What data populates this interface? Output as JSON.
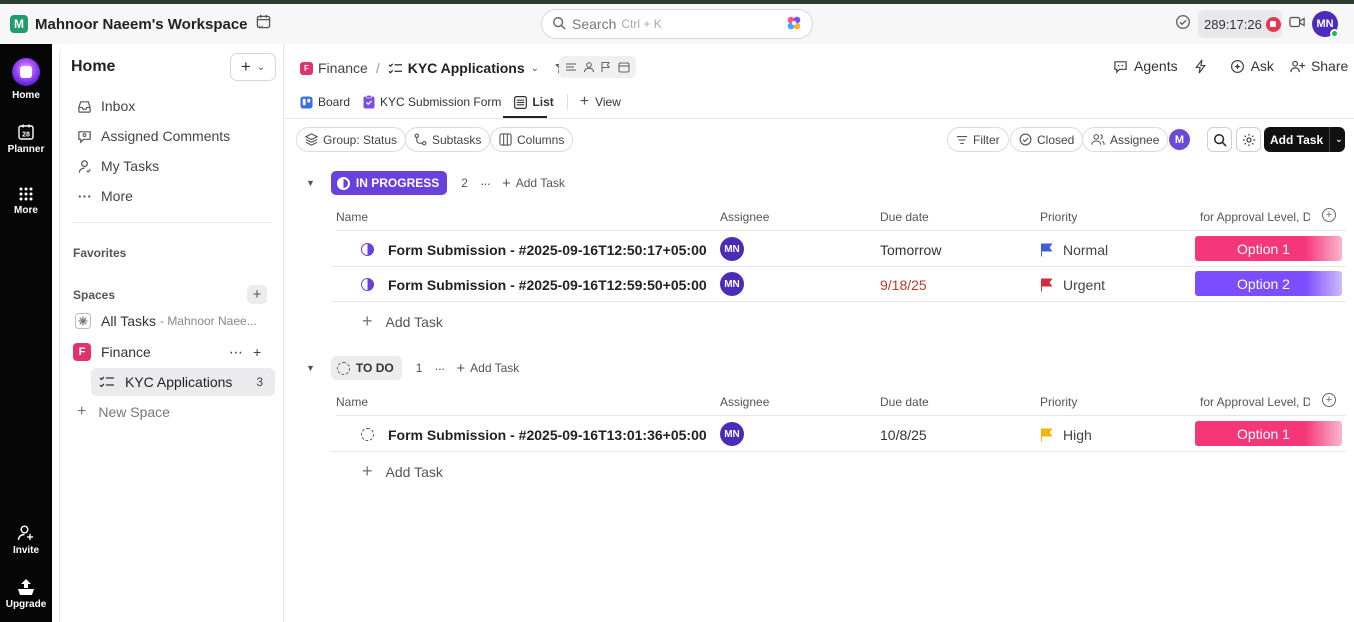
{
  "topbar": {
    "workspace_initial": "M",
    "workspace_name": "Mahnoor Naeem's Workspace",
    "search_placeholder": "Search",
    "search_shortcut": "Ctrl + K",
    "timer": "289:17:26",
    "user_initials": "MN"
  },
  "rail": {
    "items": [
      {
        "label": "Home",
        "icon": "home-icon"
      },
      {
        "label": "Planner",
        "icon": "calendar-icon"
      },
      {
        "label": "More",
        "icon": "grid-icon"
      },
      {
        "label": "Invite",
        "icon": "add-user-icon"
      },
      {
        "label": "Upgrade",
        "icon": "upgrade-icon"
      }
    ],
    "planner_day": "28"
  },
  "sidebar": {
    "title": "Home",
    "add_label": "+",
    "nav": [
      {
        "label": "Inbox",
        "icon": "inbox-icon"
      },
      {
        "label": "Assigned Comments",
        "icon": "comment-icon"
      },
      {
        "label": "My Tasks",
        "icon": "user-icon"
      },
      {
        "label": "More",
        "icon": "ellipsis-icon"
      }
    ],
    "favorites_label": "Favorites",
    "spaces_label": "Spaces",
    "all_tasks_label": "All Tasks",
    "all_tasks_sub": "- Mahnoor Naee...",
    "space_initial": "F",
    "space_name": "Finance",
    "list_name": "KYC Applications",
    "list_count": "3",
    "new_space_label": "New Space"
  },
  "header": {
    "breadcrumb_initial": "F",
    "breadcrumb_space": "Finance",
    "breadcrumb_sep": "/",
    "breadcrumb_list": "KYC Applications",
    "actions": [
      "Agents",
      "Ask",
      "Share"
    ]
  },
  "views": {
    "tabs": [
      {
        "label": "Board",
        "icon": "board-icon"
      },
      {
        "label": "KYC Submission Form",
        "icon": "form-icon"
      },
      {
        "label": "List",
        "icon": "list-icon",
        "active": true
      }
    ],
    "add_view_label": "View"
  },
  "toolbar": {
    "group_label": "Group: Status",
    "subtasks_label": "Subtasks",
    "columns_label": "Columns",
    "filter_label": "Filter",
    "closed_label": "Closed",
    "assignee_label": "Assignee",
    "me_initial": "M",
    "add_task_label": "Add Task"
  },
  "columns": {
    "name": "Name",
    "assignee": "Assignee",
    "due_date": "Due date",
    "priority": "Priority",
    "custom": "for Approval Level, D"
  },
  "groups": [
    {
      "status": "IN PROGRESS",
      "count": "2",
      "add_task": "Add Task",
      "tasks": [
        {
          "name": "Form Submission - #2025-09-16T12:50:17+05:00",
          "assignee": "MN",
          "due": "Tomorrow",
          "priority": "Normal",
          "priority_color": "#3d5ce0",
          "option": "Option 1"
        },
        {
          "name": "Form Submission - #2025-09-16T12:59:50+05:00",
          "assignee": "MN",
          "due": "9/18/25",
          "priority": "Urgent",
          "priority_color": "#d42b3a",
          "option": "Option 2"
        }
      ],
      "add_row_label": "Add Task"
    },
    {
      "status": "TO DO",
      "count": "1",
      "add_task": "Add Task",
      "tasks": [
        {
          "name": "Form Submission - #2025-09-16T13:01:36+05:00",
          "assignee": "MN",
          "due": "10/8/25",
          "priority": "High",
          "priority_color": "#f5b400",
          "option": "Option 1"
        }
      ],
      "add_row_label": "Add Task"
    }
  ],
  "colors": {
    "in_progress": "#6941dd",
    "option1": "#f5377a",
    "option2": "#7c4dff",
    "accent": "#4a2cb8"
  }
}
